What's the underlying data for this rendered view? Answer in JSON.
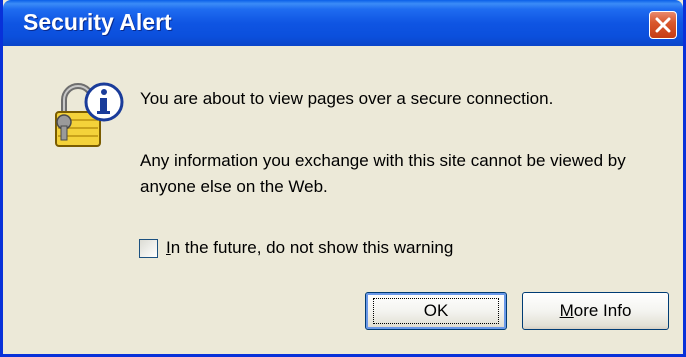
{
  "window": {
    "title": "Security Alert",
    "close_icon": "close-icon"
  },
  "icon": "lock-info-icon",
  "messages": {
    "line1": "You are about to view pages over a secure connection.",
    "line2": "Any information you exchange with this site cannot be viewed by anyone else on the Web."
  },
  "checkbox": {
    "label_mnemonic": "I",
    "label_rest": "n the future, do not show this warning",
    "checked": false
  },
  "buttons": {
    "ok": "OK",
    "more_mnemonic": "M",
    "more_rest": "ore Info"
  },
  "colors": {
    "titlebar": "#0B4FDC",
    "window_bg": "#ECE9D8",
    "close": "#D9582E"
  }
}
